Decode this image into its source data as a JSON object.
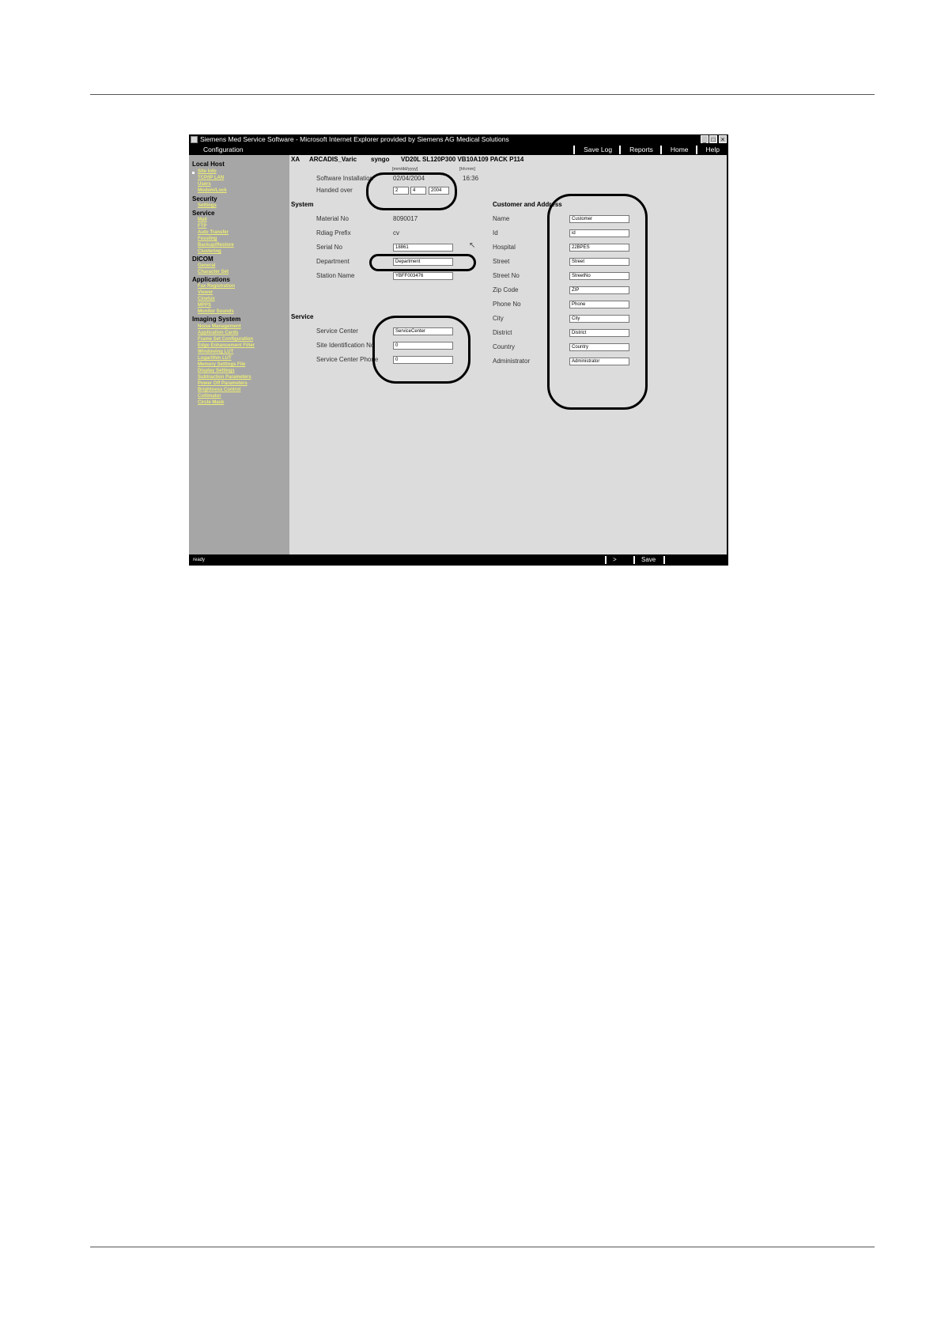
{
  "window": {
    "title": "Siemens Med Service Software - Microsoft Internet Explorer provided by Siemens AG Medical Solutions",
    "minimize": "_",
    "maximize": "□",
    "close": "×"
  },
  "menubar": {
    "configuration": "Configuration",
    "save_log": "Save Log",
    "reports": "Reports",
    "home": "Home",
    "help": "Help"
  },
  "sidebar": {
    "local_host": "Local Host",
    "local_host_items": [
      "Site Info",
      "TCP/IP LAN",
      "Users",
      "Modem/Lock"
    ],
    "security": "Security",
    "security_items": [
      "Settings"
    ],
    "service": "Service",
    "service_items": [
      "Mail",
      "FTP",
      "Auto Transfer",
      "Fessling",
      "Backup/Restore",
      "Clustering"
    ],
    "dicom": "DICOM",
    "dicom_items": [
      "General",
      "Character Set"
    ],
    "applications": "Applications",
    "applications_items": [
      "Fax Registration",
      "Viewer",
      "Cinelux",
      "MPPS",
      "Monitor Sounds"
    ],
    "imaging_system": "Imaging System",
    "imaging_items": [
      "Noise Management",
      "Application Cards",
      "Frame Set Configuration",
      "Edge Enhancement Filter",
      "Windowing LUT",
      "Logarithm LUT",
      "Memory Settings File",
      "Display Settings",
      "Subtraction Parameters",
      "Power Off Parameters",
      "Brightness Control",
      "Collimator",
      "Circle Mask"
    ]
  },
  "product": {
    "modality": "XA",
    "name": "ARCADIS_Varic",
    "platform": "syngo",
    "version": "VD20L SL120P300 VB10A109 PACK P114"
  },
  "units": {
    "date": "[mm/dd/yyyy]",
    "time": "[hh:mm]"
  },
  "install": {
    "software_label": "Software Installation",
    "software_date": "02/04/2004",
    "software_time": "16:36",
    "handed_label": "Handed over",
    "handed_month": "2",
    "handed_day": "4",
    "handed_year": "2004"
  },
  "system": {
    "heading": "System",
    "material_label": "Material No",
    "material_value": "8090017",
    "rdiag_label": "Rdiag Prefix",
    "rdiag_value": "cv",
    "serial_label": "Serial No",
    "serial_value": "18861",
    "department_label": "Department",
    "department_value": "Department",
    "station_label": "Station Name",
    "station_value": "YBFF003476"
  },
  "service": {
    "heading": "Service",
    "center_label": "Service Center",
    "center_value": "ServiceCenter",
    "site_label": "Site Identification No",
    "site_value": "0",
    "phone_label": "Service Center Phone",
    "phone_value": "0"
  },
  "customer": {
    "heading": "Customer and Address",
    "fields": [
      {
        "label": "Name",
        "value": "Customer"
      },
      {
        "label": "Id",
        "value": "id"
      },
      {
        "label": "Hospital",
        "value": "22BPES"
      },
      {
        "label": "Street",
        "value": "Street"
      },
      {
        "label": "Street No",
        "value": "StreetNo"
      },
      {
        "label": "Zip Code",
        "value": "ZIP"
      },
      {
        "label": "Phone No",
        "value": "Phone"
      },
      {
        "label": "City",
        "value": "City"
      },
      {
        "label": "District",
        "value": "District"
      },
      {
        "label": "Country",
        "value": "Country"
      },
      {
        "label": "Administrator",
        "value": "Administrator"
      }
    ]
  },
  "status": {
    "left": "ready",
    "arrow": ">",
    "save": "Save"
  }
}
